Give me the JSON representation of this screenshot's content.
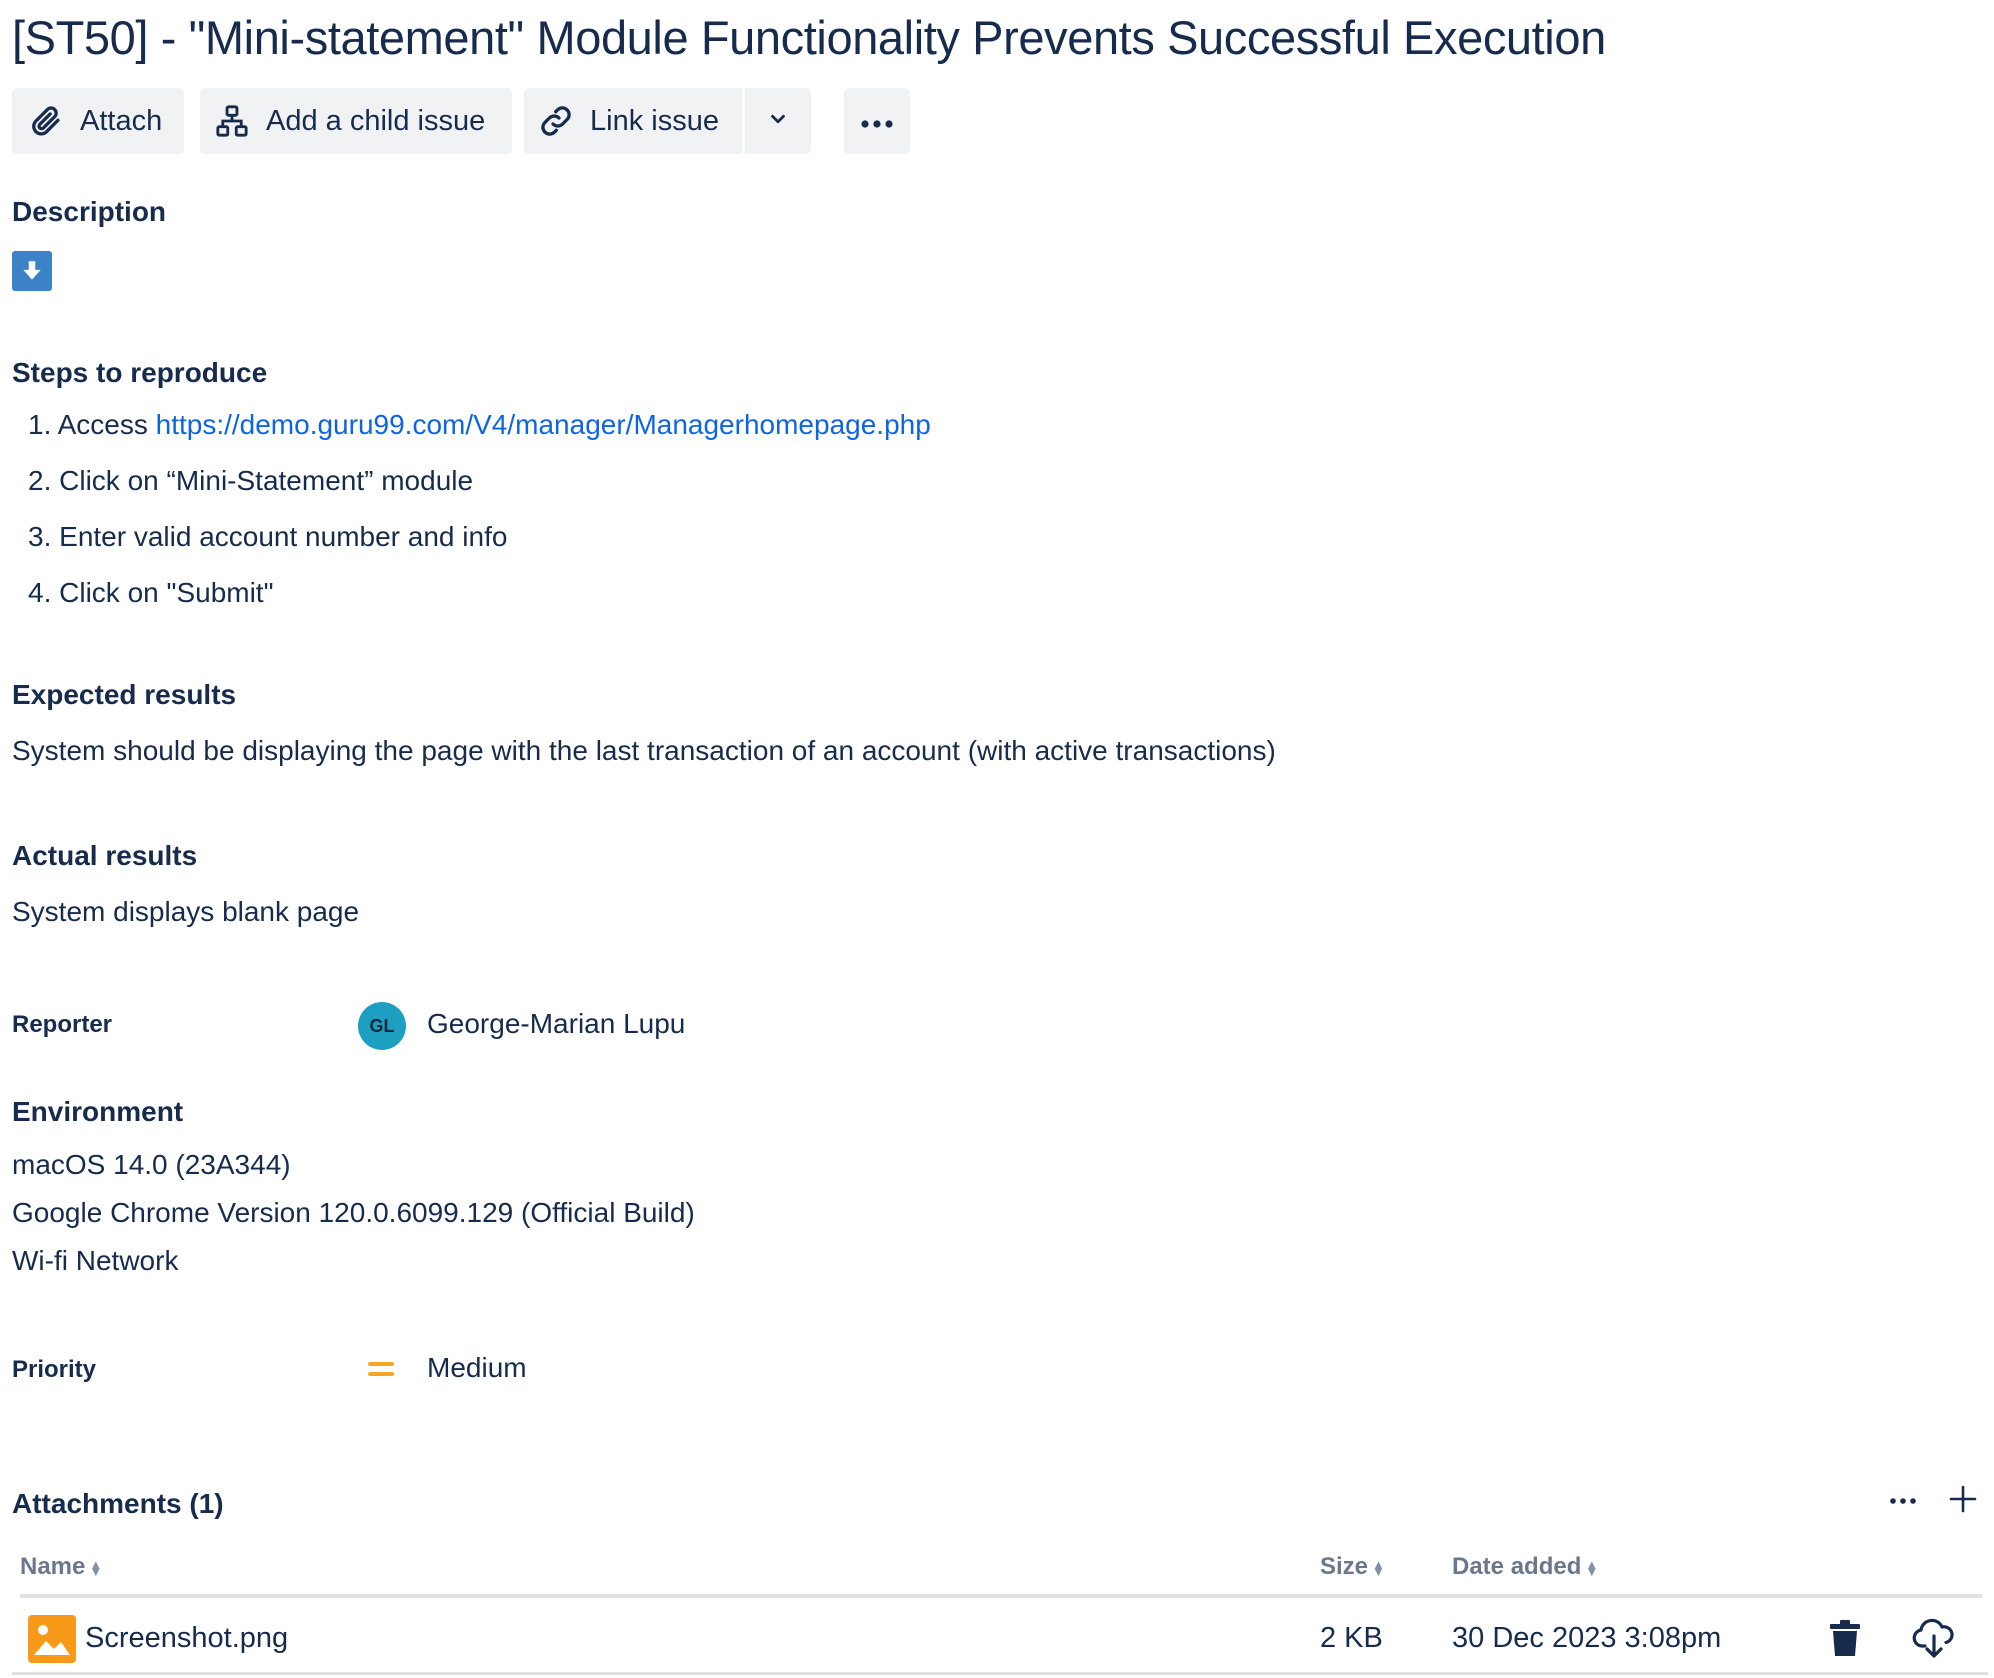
{
  "issue": {
    "title": "[ST50] - \"Mini-statement\" Module Functionality Prevents Successful Execution"
  },
  "toolbar": {
    "attach_label": "Attach",
    "attach_icon": "paperclip-icon",
    "child_label": "Add a child issue",
    "child_icon": "hierarchy-icon",
    "link_label": "Link issue",
    "link_icon": "link-icon",
    "split_icon": "chevron-down-icon",
    "more_icon": "more-horizontal-icon"
  },
  "description": {
    "heading": "Description",
    "download_icon": "download-arrow-icon"
  },
  "steps": {
    "heading": "Steps to reproduce",
    "items": [
      {
        "num": "1.",
        "text": "Access ",
        "link": "https://demo.guru99.com/V4/manager/Managerhomepage.php"
      },
      {
        "num": "2.",
        "text": "Click on “Mini-Statement” module"
      },
      {
        "num": "3.",
        "text": "Enter valid account number and info"
      },
      {
        "num": "4.",
        "text": "Click on \"Submit\""
      }
    ]
  },
  "expected": {
    "heading": "Expected results",
    "text": "System should be displaying the page with the last transaction of an account (with active transactions)"
  },
  "actual": {
    "heading": "Actual results",
    "text": "System displays blank page"
  },
  "reporter": {
    "label": "Reporter",
    "initials": "GL",
    "name": "George-Marian Lupu",
    "avatar_color": "#1d9fc1"
  },
  "environment": {
    "heading": "Environment",
    "lines": [
      "macOS 14.0 (23A344)",
      "Google Chrome Version 120.0.6099.129 (Official Build)",
      "Wi-fi Network"
    ]
  },
  "priority": {
    "label": "Priority",
    "value": "Medium",
    "icon": "priority-medium-icon",
    "color": "#f5a623"
  },
  "attachments": {
    "heading": "Attachments (1)",
    "more_icon": "more-horizontal-icon",
    "add_icon": "plus-icon",
    "columns": {
      "name": "Name",
      "size": "Size",
      "date": "Date added"
    },
    "rows": [
      {
        "name": "Screenshot.png",
        "size": "2 KB",
        "date": "30 Dec 2023 3:08pm",
        "file_icon": "image-file-icon"
      }
    ],
    "delete_icon": "trash-icon",
    "download_icon": "cloud-download-icon"
  },
  "colors": {
    "text": "#172b4d",
    "link": "#0c66e4",
    "button_bg": "#f1f2f4",
    "header_gray": "#6b778c"
  }
}
